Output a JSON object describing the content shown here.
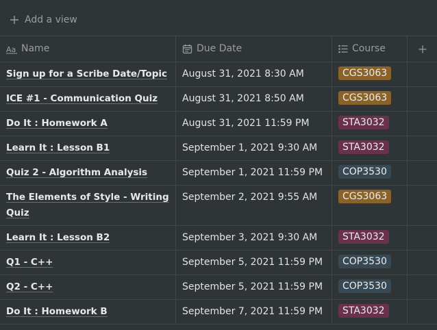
{
  "toolbar": {
    "add_view_label": "Add a view"
  },
  "columns": [
    {
      "label": "Name",
      "icon": "text-property-icon"
    },
    {
      "label": "Due Date",
      "icon": "calendar-icon"
    },
    {
      "label": "Course",
      "icon": "list-icon"
    }
  ],
  "colors": {
    "CGS3063": "#89632a",
    "STA3032": "#69314c",
    "COP3530": "#364954"
  },
  "rows": [
    {
      "name": "Sign up for a Scribe Date/Topic",
      "due": "August 31, 2021 8:30 AM",
      "course": "CGS3063"
    },
    {
      "name": "ICE #1 - Communication Quiz",
      "due": "August 31, 2021 8:50 AM",
      "course": "CGS3063"
    },
    {
      "name": "Do It : Homework A",
      "due": "August 31, 2021 11:59 PM",
      "course": "STA3032"
    },
    {
      "name": "Learn It : Lesson B1",
      "due": "September 1, 2021 9:30 AM",
      "course": "STA3032"
    },
    {
      "name": "Quiz 2 - Algorithm Analysis",
      "due": "September 1, 2021 11:59 PM",
      "course": "COP3530"
    },
    {
      "name": "The Elements of Style - Writing Quiz",
      "due": "September 2, 2021 9:55 AM",
      "course": "CGS3063"
    },
    {
      "name": "Learn It : Lesson B2",
      "due": "September 3, 2021 9:30 AM",
      "course": "STA3032"
    },
    {
      "name": "Q1 - C++",
      "due": "September 5, 2021 11:59 PM",
      "course": "COP3530"
    },
    {
      "name": "Q2 - C++",
      "due": "September 5, 2021 11:59 PM",
      "course": "COP3530"
    },
    {
      "name": "Do It : Homework B",
      "due": "September 7, 2021 11:59 PM",
      "course": "STA3032"
    }
  ]
}
